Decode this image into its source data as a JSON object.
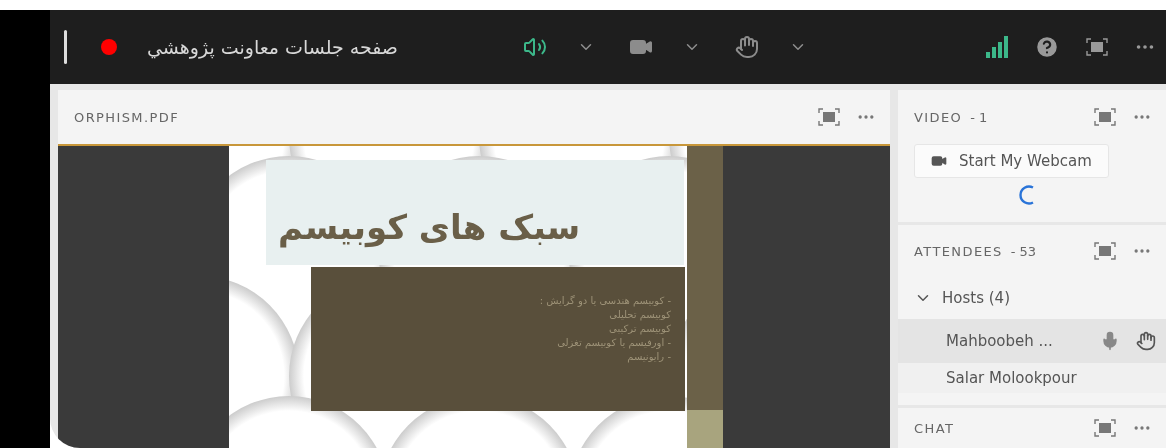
{
  "top_bar": {
    "recording": true,
    "title": "صفحه جلسات معاونت پژوهشي",
    "controls": [
      {
        "kind": "speaker",
        "active": true
      },
      {
        "kind": "camera",
        "active": false
      },
      {
        "kind": "hand",
        "active": false
      }
    ]
  },
  "share_pod": {
    "title": "ORPHISM.PDF",
    "slide": {
      "title": "سبک های کوبیسم",
      "lines": [
        "- کوبیسم هندسی یا دو گرایش :",
        "کوبیسم تحلیلی",
        "کوبیسم ترکیبی",
        "- اورفیسم یا کوبیسم تغزلی",
        "- رایونیسم"
      ]
    }
  },
  "video_pod": {
    "title": "VIDEO",
    "count": "- 1",
    "button": "Start My Webcam"
  },
  "attendees_pod": {
    "title": "ATTENDEES",
    "count": "- 53",
    "groups": [
      {
        "label": "Hosts (4)",
        "expanded": true,
        "children": [
          {
            "name": "Mahboobeh ...",
            "selected": true,
            "mic": true,
            "hand": true
          },
          {
            "name": "Salar Molookpour",
            "selected": false
          }
        ]
      }
    ]
  },
  "chat_pod": {
    "title": "CHAT"
  }
}
